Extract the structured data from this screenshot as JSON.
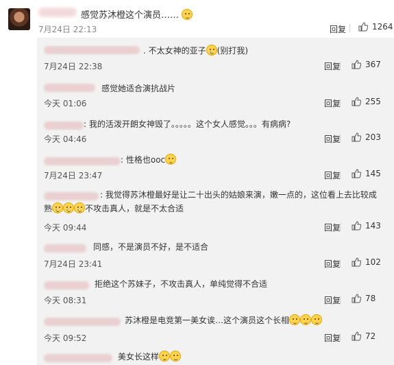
{
  "main_comment": {
    "text": "感觉苏沐橙这个演员……",
    "time": "7月24日 22:13",
    "reply_label": "回复",
    "likes": "1264"
  },
  "replies": [
    {
      "text": ". 不太女神的亚子",
      "suffix": "(别打我)",
      "time": "7月24日 22:38",
      "reply_label": "回复",
      "likes": "367"
    },
    {
      "text": "感觉她适合演抗战片",
      "time": "今天 01:06",
      "reply_label": "回复",
      "likes": "255"
    },
    {
      "text": ": 我的活泼开朗女神毁了。。。。。这个女人感觉。。。有病病?",
      "time": "今天 04:46",
      "reply_label": "回复",
      "likes": "203"
    },
    {
      "text": ": 性格也ooc",
      "time": "7月24日 23:47",
      "reply_label": "回复",
      "likes": "145"
    },
    {
      "text_line1": ": 我觉得苏沐橙最好是让二十出头的姑娘来演，嫩一点的，这位看上去比较成",
      "text_line2_prefix": "熟",
      "text_line2_suffix": "不攻击真人，就是不太合适",
      "time": "今天 09:44",
      "reply_label": "回复",
      "likes": "143"
    },
    {
      "text": "同感，不是演员不好，是不适合",
      "time": "7月24日 23:41",
      "reply_label": "回复",
      "likes": "102"
    },
    {
      "text": "拒绝这个苏妹子，不攻击真人，单纯觉得不合适",
      "time": "今天 08:31",
      "reply_label": "回复",
      "likes": "78"
    },
    {
      "text": "苏沐橙是电竞第一美女诶…这个演员这个长相",
      "time": "今天 09:52",
      "reply_label": "回复",
      "likes": "72"
    },
    {
      "text": "美女长这样"
    }
  ],
  "colors": {
    "blurred_name": "#ead0d0",
    "reply_bg": "#f2f2f2",
    "emoji": "#ffd34d"
  },
  "icons": {
    "like": "thumbs-up-icon",
    "emoji": "doge-emoji-icon"
  }
}
